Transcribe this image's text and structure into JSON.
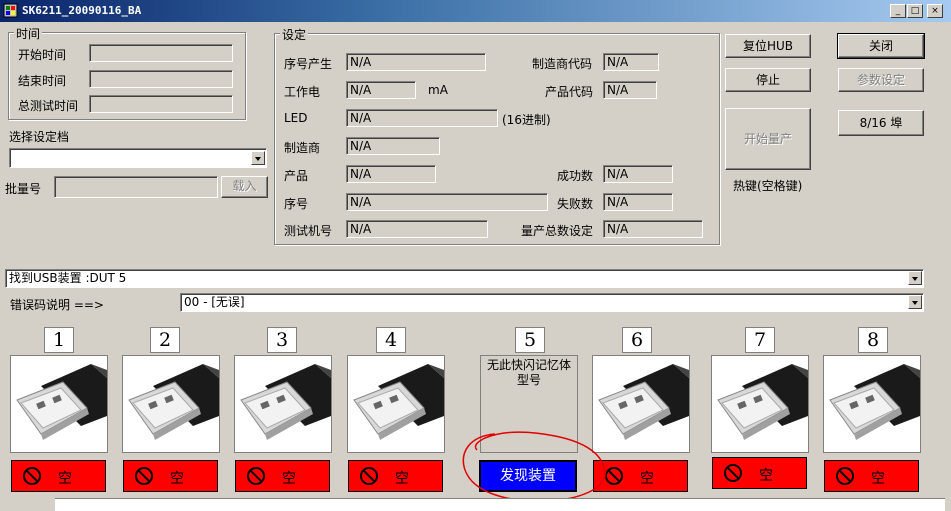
{
  "window": {
    "title": "SK6211_20090116_BA",
    "min": "_",
    "max": "□",
    "close": "×"
  },
  "time_group": {
    "title": "时间",
    "start_label": "开始时间",
    "start_value": "",
    "end_label": "结束时间",
    "end_value": "",
    "total_label": "总测试时间",
    "total_value": ""
  },
  "profile": {
    "label": "选择设定档",
    "value": ""
  },
  "batch": {
    "label": "批量号",
    "value": "",
    "load_button": "载入"
  },
  "settings": {
    "title": "设定",
    "serial_gen_label": "序号产生",
    "serial_gen_value": "N/A",
    "vendor_code_label": "制造商代码",
    "vendor_code_value": "N/A",
    "current_label": "工作电",
    "current_value": "N/A",
    "current_unit": "mA",
    "product_code_label": "产品代码",
    "product_code_value": "N/A",
    "led_label": "LED",
    "led_value": "N/A",
    "led_unit": "(16进制)",
    "vendor_label": "制造商",
    "vendor_value": "N/A",
    "product_label": "产品",
    "product_value": "N/A",
    "success_label": "成功数",
    "success_value": "N/A",
    "serial_label": "序号",
    "serial_value": "N/A",
    "fail_label": "失败数",
    "fail_value": "N/A",
    "machine_label": "测试机号",
    "machine_value": "N/A",
    "total_set_label": "量产总数设定",
    "total_set_value": "N/A"
  },
  "buttons": {
    "reset_hub": "复位HUB",
    "close": "关闭",
    "stop": "停止",
    "params": "参数设定",
    "start": "开始量产",
    "ports": "8/16 埠",
    "hotkey": "热键(空格键)"
  },
  "usb_found": "找到USB装置 :DUT 5",
  "error": {
    "label": "错误码说明 ==>",
    "value": "00 - [无误]"
  },
  "slots": [
    {
      "num": "1",
      "status": "空"
    },
    {
      "num": "2",
      "status": "空"
    },
    {
      "num": "3",
      "status": "空"
    },
    {
      "num": "4",
      "status": "空"
    },
    {
      "num": "5",
      "message": "无此快闪记忆体型号",
      "status": "发现装置"
    },
    {
      "num": "6",
      "status": "空"
    },
    {
      "num": "7",
      "status": "空"
    },
    {
      "num": "8",
      "status": "空"
    }
  ],
  "colors": {
    "empty_status": "#ff0000",
    "found_status": "#0000ff",
    "annotation": "#e00000"
  }
}
